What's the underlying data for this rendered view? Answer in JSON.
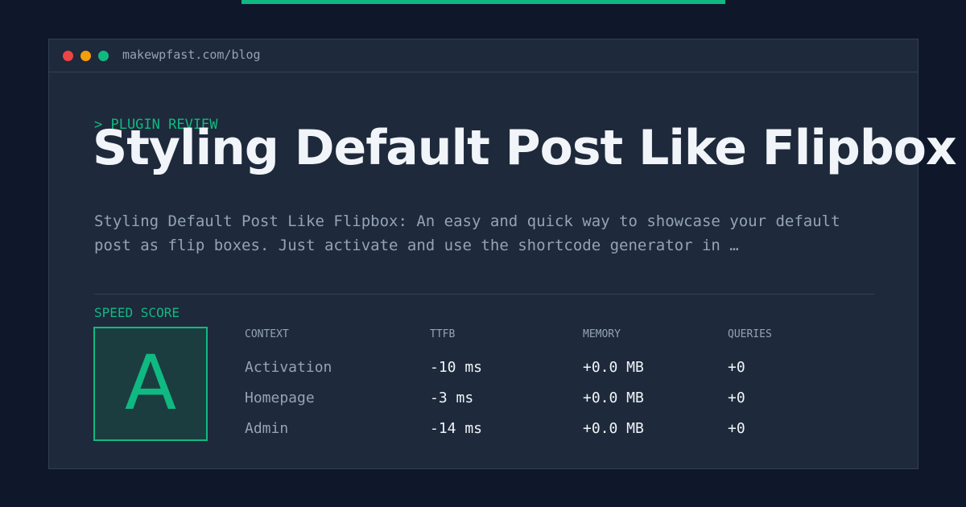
{
  "window": {
    "url": "makewpfast.com/blog"
  },
  "post": {
    "kicker": "> PLUGIN REVIEW",
    "title": "Styling Default Post Like Flipbox",
    "excerpt": "Styling Default Post Like Flipbox: An easy and quick way to showcase your default post as flip boxes. Just activate and use the shortcode generator in …"
  },
  "speed": {
    "label": "SPEED SCORE",
    "grade": "A"
  },
  "metrics": {
    "headers": [
      "CONTEXT",
      "TTFB",
      "MEMORY",
      "QUERIES"
    ],
    "rows": [
      [
        "Activation",
        "-10 ms",
        "+0.0 MB",
        "+0"
      ],
      [
        "Homepage",
        "-3 ms",
        "+0.0 MB",
        "+0"
      ],
      [
        "Admin",
        "-14 ms",
        "+0.0 MB",
        "+0"
      ]
    ]
  },
  "colors": {
    "background": "#0f172a",
    "panel": "#1e293b",
    "accent": "#10b981",
    "muted_text": "#94a3b8",
    "primary_text": "#f1f5f9",
    "window_dot_red": "#ef4444",
    "window_dot_amber": "#f59e0b",
    "window_dot_green": "#10b981"
  }
}
